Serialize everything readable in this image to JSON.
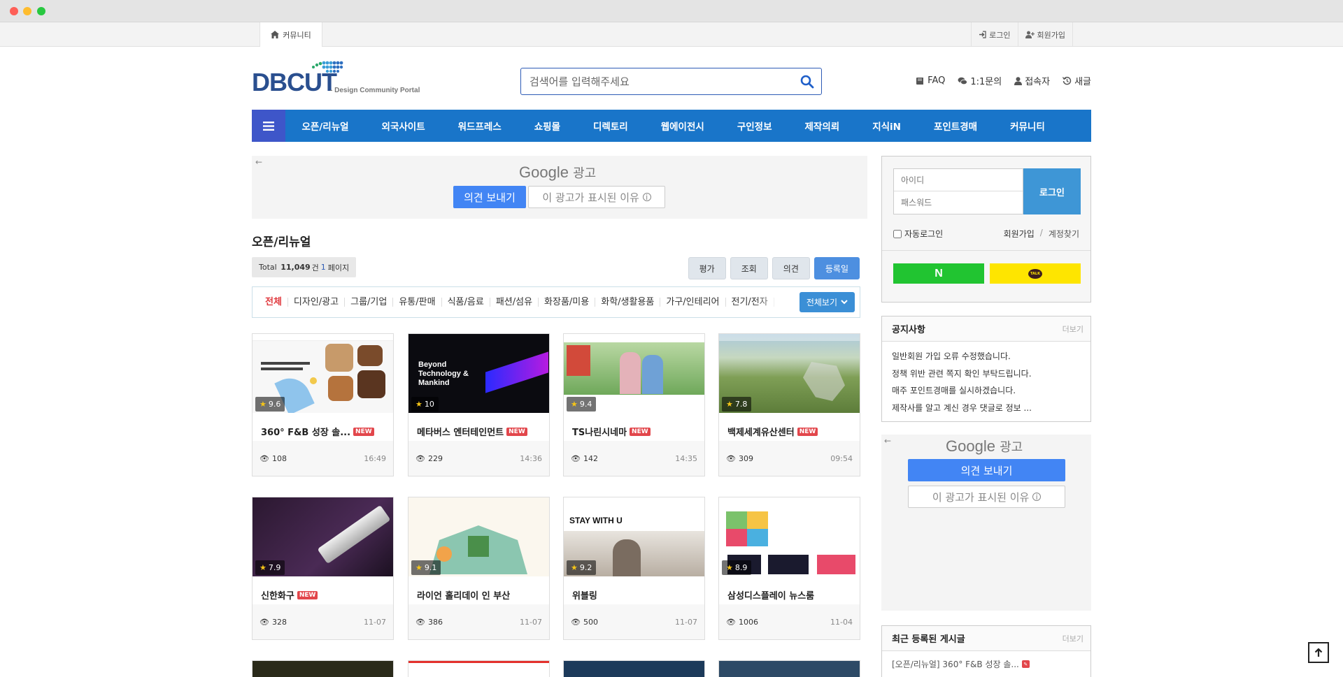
{
  "topbar": {
    "community_tab": "커뮤니티",
    "login": "로그인",
    "signup": "회원가입"
  },
  "header": {
    "logo_text": "DBCUT",
    "logo_sub": "- Design Community Portal",
    "search_placeholder": "검색어를 입력해주세요",
    "links": {
      "faq": "FAQ",
      "inquiry": "1:1문의",
      "visitors": "접속자",
      "new_posts": "새글"
    }
  },
  "nav": {
    "items": [
      "오픈/리뉴얼",
      "외국사이트",
      "워드프레스",
      "쇼핑몰",
      "디렉토리",
      "웹에이전시",
      "구인정보",
      "제작의뢰",
      "지식iN",
      "포인트경매",
      "커뮤니티"
    ]
  },
  "ads": {
    "brand": "Google",
    "label": "광고",
    "feedback": "의견 보내기",
    "why": "이 광고가 표시된 이유"
  },
  "main": {
    "title": "오픈/리뉴얼",
    "total_label": "Total",
    "total_count": "11,049",
    "total_unit": "건",
    "page_num": "1",
    "page_unit": "페이지",
    "sort": [
      "평가",
      "조회",
      "의견",
      "등록일"
    ],
    "categories": [
      "전체",
      "디자인/광고",
      "그룹/기업",
      "유통/판매",
      "식품/음료",
      "패션/섬유",
      "화장품/미용",
      "화학/생활용품",
      "가구/인테리어",
      "전기/전자"
    ],
    "view_all": "전체보기",
    "new_badge": "NEW",
    "cards": [
      {
        "title": "360° F&B 성장 솔...",
        "score": "9.6",
        "views": "108",
        "time": "16:49",
        "is_new": true
      },
      {
        "title": "메타버스 엔터테인먼트",
        "score": "10",
        "views": "229",
        "time": "14:36",
        "is_new": true,
        "thumb_text": "Beyond Technology & Mankind"
      },
      {
        "title": "TS나린시네마",
        "score": "9.4",
        "views": "142",
        "time": "14:35",
        "is_new": true
      },
      {
        "title": "백제세계유산센터",
        "score": "7.8",
        "views": "309",
        "time": "09:54",
        "is_new": true
      },
      {
        "title": "신한화구",
        "score": "7.9",
        "views": "328",
        "time": "11-07",
        "is_new": true
      },
      {
        "title": "라이언 홀리데이 인 부산",
        "score": "9.1",
        "views": "386",
        "time": "11-07",
        "is_new": false
      },
      {
        "title": "위블링",
        "score": "9.2",
        "views": "500",
        "time": "11-07",
        "is_new": false,
        "thumb_text": "STAY WITH U"
      },
      {
        "title": "삼성디스플레이 뉴스룸",
        "score": "8.9",
        "views": "1006",
        "time": "11-04",
        "is_new": false
      }
    ]
  },
  "sidebar": {
    "id_placeholder": "아이디",
    "pw_placeholder": "패스워드",
    "login_button": "로그인",
    "auto_login": "자동로그인",
    "signup": "회원가입",
    "separator": "/",
    "find_account": "계정찾기",
    "naver": "N",
    "kakao": "TALK",
    "notice": {
      "title": "공지사항",
      "more": "더보기",
      "items": [
        "일반회원 가입 오류 수정했습니다.",
        "정책 위반 관련 쪽지 확인 부탁드립니다.",
        "매주 포인트경매를 실시하겠습니다.",
        "제작사를 알고 계신 경우 댓글로 정보 ..."
      ]
    },
    "recent": {
      "title": "최근 등록된 게시글",
      "more": "더보기",
      "items": [
        "[오픈/리뉴얼] 360° F&B 성장 솔..."
      ]
    }
  },
  "colors": {
    "nav_bg": "#1975c9",
    "burger_bg": "#3e56c9",
    "brand": "#2a4f8f",
    "new_badge": "#e2464b",
    "naver": "#21c431",
    "kakao": "#fee500"
  }
}
